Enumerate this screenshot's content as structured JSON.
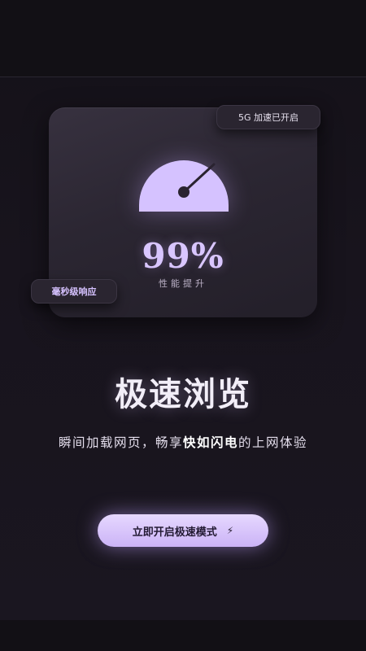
{
  "card": {
    "speed_value": "99%",
    "speed_label": "性能提升",
    "badge_5g": "5G 加速已开启",
    "badge_latency": "毫秒级响应"
  },
  "hero": {
    "title": "极速浏览",
    "desc_part1": "瞬间加载网页，畅享",
    "desc_highlight": "快如闪电",
    "desc_part2": "的上网体验"
  },
  "cta": {
    "label": "立即开启极速模式",
    "icon": "lightning-icon"
  },
  "colors": {
    "accent": "#d5c2ff",
    "background": "#18141d",
    "card": "#2c2733"
  }
}
